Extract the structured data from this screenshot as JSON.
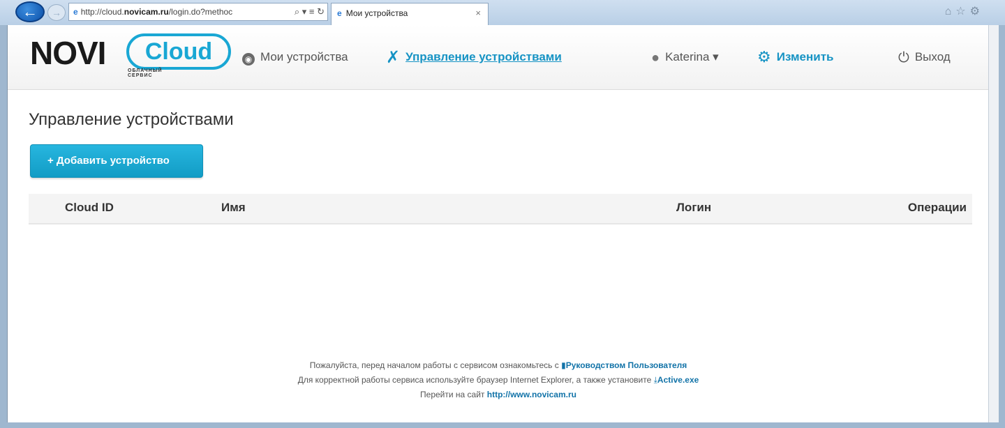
{
  "browser": {
    "url_prefix": "http://cloud.",
    "url_host": "novicam.ru",
    "url_rest": "/login.do?methoc",
    "address_tools": "⌕ ▾ ≡ ↻",
    "tab_title": "Мои устройства",
    "tab_close": "×",
    "chrome_icons": "⌂☆⚙"
  },
  "logo": {
    "main": "NOVI",
    "cloud": "Cloud",
    "subtitle": "ОБЛАЧНЫЙ СЕРВИС"
  },
  "nav": {
    "devices": "Мои устройства",
    "manage": "Управление устройствами",
    "user": "Katerina",
    "edit": "Изменить",
    "logout": "Выход"
  },
  "page": {
    "title": "Управление устройствами",
    "add_button": "+ Добавить устройство"
  },
  "table": {
    "columns": [
      "Cloud ID",
      "Имя",
      "Логин",
      "Операции"
    ]
  },
  "footer": {
    "line1_text": "Пожалуйста, перед началом работы с сервисом ознакомьтесь с",
    "line1_link": "Руководством Пользователя",
    "line2_text": "Для корректной работы сервиса используйте браузер Internet Explorer, а также установите",
    "line2_link": "Active.exe",
    "line3_text": "Перейти на сайт",
    "line3_link": "http://www.novicam.ru"
  },
  "colors": {
    "accent": "#1693c4",
    "button": "#1aa8d4",
    "link": "#1273a8"
  },
  "icons": {
    "devices": "globe-icon",
    "manage": "tools-icon",
    "user": "user-icon",
    "edit": "gear-icon",
    "logout": "power-icon",
    "manual": "document-icon",
    "download": "download-icon"
  }
}
